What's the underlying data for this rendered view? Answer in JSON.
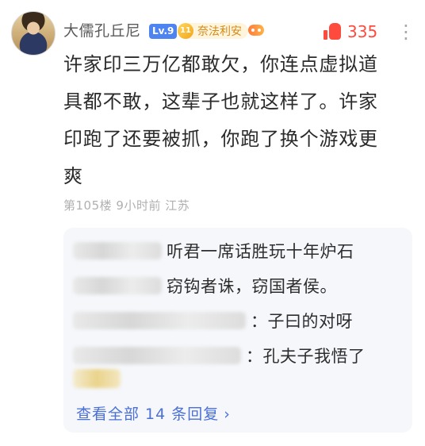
{
  "header": {
    "username": "大儒孔丘尼",
    "level": "Lv.9",
    "fan_badge_number": "11",
    "fan_badge_label": "奈法利安",
    "like_count": "335"
  },
  "post": {
    "line1": "许家印三万亿都敢欠，你连点虚拟道",
    "line2": "具都不敢，这辈子也就这样了。许家",
    "line3": "印跑了还要被抓，你跑了换个游戏更",
    "line4": "爽",
    "meta": "第105楼  9小时前  江苏"
  },
  "replies": {
    "items": [
      {
        "text": "听君一席话胜玩十年炉石"
      },
      {
        "text": "窃钩者诛，窃国者侯。"
      },
      {
        "text": "：子曰的对呀"
      },
      {
        "text": "：孔夫子我悟了"
      }
    ],
    "view_more": "查看全部 14 条回复"
  },
  "icons": {
    "thumb": "thumbs-up-icon",
    "more": "more-vertical-icon",
    "game": "gamepad-icon",
    "fan": "diamond-badge-icon"
  },
  "colors": {
    "accent_like": "#ff4b3e",
    "accent_link": "#4a6fd6",
    "level_badge": "#4e84f1"
  }
}
